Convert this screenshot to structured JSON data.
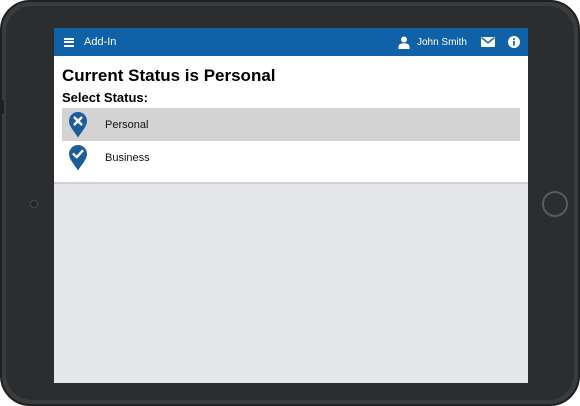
{
  "app": {
    "title": "Add-In",
    "menu_icon": "menu-icon",
    "user": {
      "icon": "user-icon",
      "name": "John Smith"
    },
    "mail_icon": "mail-icon",
    "info_icon": "info-icon"
  },
  "main": {
    "heading": "Current Status is Personal",
    "subheading": "Select Status:",
    "statuses": [
      {
        "label": "Personal",
        "icon": "pin-x-icon",
        "selected": true
      },
      {
        "label": "Business",
        "icon": "pin-check-icon",
        "selected": false
      }
    ]
  },
  "colors": {
    "brand": "#0f62a7",
    "selected_row": "#d3d3d3",
    "screen_background": "#e5e6ea"
  }
}
